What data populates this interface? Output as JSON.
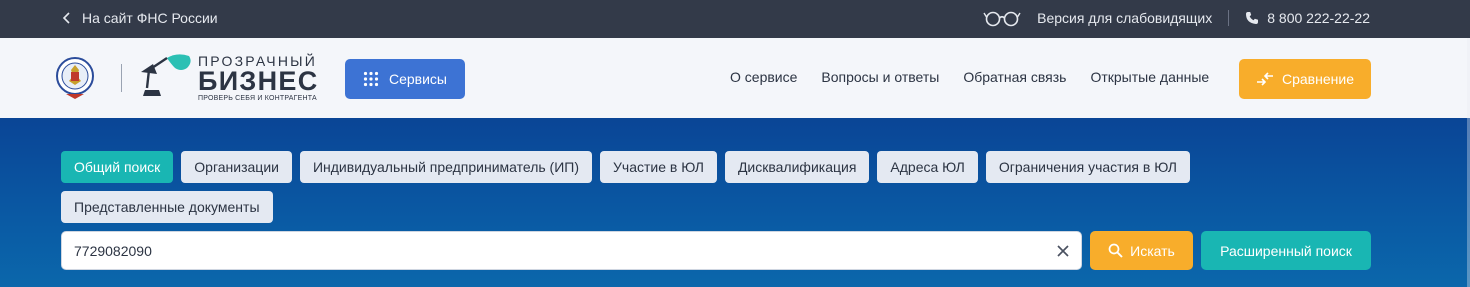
{
  "topbar": {
    "back_link": "На сайт ФНС России",
    "accessibility_link": "Версия для слабовидящих",
    "phone": "8 800 222-22-22"
  },
  "header": {
    "brand_line1": "ПРОЗРАЧНЫЙ",
    "brand_line2": "БИЗНЕС",
    "brand_line3": "ПРОВЕРЬ СЕБЯ И КОНТРАГЕНТА",
    "services_label": "Сервисы",
    "nav": [
      "О сервисе",
      "Вопросы и ответы",
      "Обратная связь",
      "Открытые данные"
    ],
    "compare_label": "Сравнение"
  },
  "search": {
    "tabs": [
      "Общий поиск",
      "Организации",
      "Индивидуальный предприниматель (ИП)",
      "Участие в ЮЛ",
      "Дисквалификация",
      "Адреса ЮЛ",
      "Ограничения участия в ЮЛ",
      "Представленные документы"
    ],
    "active_tab": "Общий поиск",
    "query": "7729082090",
    "find_label": "Искать",
    "advanced_label": "Расширенный поиск"
  },
  "colors": {
    "topbar_bg": "#333a49",
    "accent_blue": "#3d73d4",
    "accent_orange": "#f8ad2b",
    "accent_teal": "#19b6b3",
    "hero_bg": "#0a4f94"
  },
  "icons": {
    "back": "chevron-left-icon",
    "accessibility": "glasses-icon",
    "phone": "phone-icon",
    "services": "grid-dots-icon",
    "compare": "compare-arrows-icon",
    "clear": "close-icon",
    "find": "search-icon"
  }
}
